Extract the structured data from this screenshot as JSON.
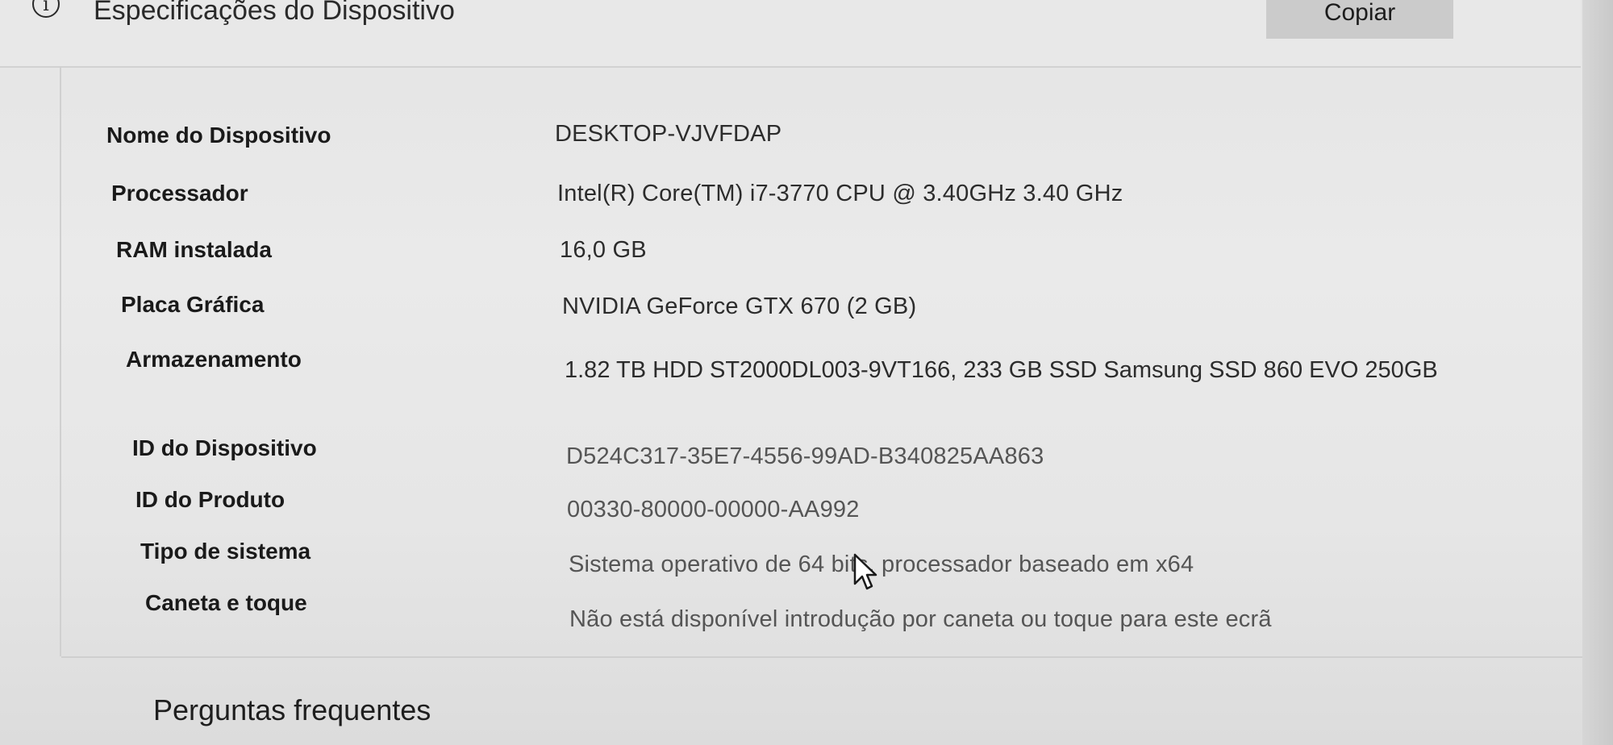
{
  "header": {
    "title": "Especificações do Dispositivo",
    "info_icon_glyph": "i",
    "copy_label": "Copiar"
  },
  "specs": [
    {
      "label": "Nome do Dispositivo",
      "value": "DESKTOP-VJVFDAP"
    },
    {
      "label": "Processador",
      "value": "Intel(R) Core(TM) i7-3770 CPU @ 3.40GHz   3.40 GHz"
    },
    {
      "label": "RAM instalada",
      "value": "16,0 GB"
    },
    {
      "label": "Placa Gráfica",
      "value": "NVIDIA GeForce GTX 670 (2 GB)"
    },
    {
      "label": "Armazenamento",
      "value": "1.82 TB HDD ST2000DL003-9VT166, 233 GB SSD Samsung SSD 860 EVO 250GB"
    },
    {
      "label": "ID do Dispositivo",
      "value": "D524C317-35E7-4556-99AD-B340825AA863"
    },
    {
      "label": "ID do Produto",
      "value": "00330-80000-00000-AA992"
    },
    {
      "label": "Tipo de sistema",
      "value": "Sistema operativo de 64 bits, processador baseado em x64"
    },
    {
      "label": "Caneta e toque",
      "value": "Não está disponível introdução por caneta ou toque para este ecrã"
    }
  ],
  "faq": {
    "label": "Perguntas frequentes"
  },
  "icons": {
    "info": "info-circle-icon",
    "collapse": "chevron-up-icon",
    "cursor": "mouse-pointer-icon"
  }
}
